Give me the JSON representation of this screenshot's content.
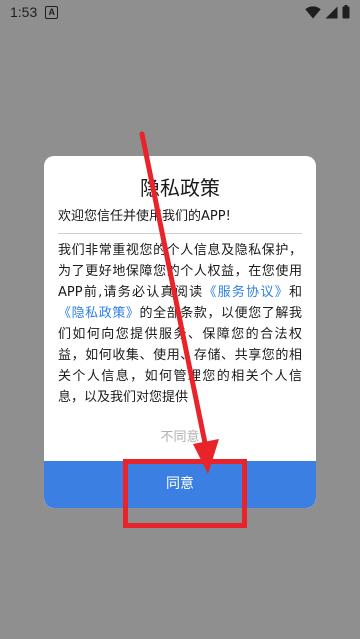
{
  "status_bar": {
    "time": "1:53",
    "notification_letter": "A"
  },
  "dialog": {
    "title": "隐私政策",
    "welcome": "欢迎您信任并使用我们的APP!",
    "body": {
      "part1": "我们非常重视您的个人信息及隐私保护，为了更好地保障您的个人权益，在您使用APP前,请务必认真阅读",
      "link1": "《服务协议》",
      "part2": "和",
      "link2": "《隐私政策》",
      "part3": "的全部条款，以便您了解我们如何向您提供服务、保障您的合法权益，如何收集、使用、存储、共享您的相关个人信息，如何管理您的相关个人信息，以及我们对您提供"
    },
    "disagree_label": "不同意",
    "agree_label": "同意"
  },
  "colors": {
    "overlay_background": "#8f8f8f",
    "agree_button": "#3c7fe3",
    "link": "#2f7fe6",
    "annotation_red": "#e8232a"
  },
  "icons": [
    "wifi-icon",
    "cellular-signal-icon",
    "battery-icon",
    "red-arrow-annotation",
    "red-box-annotation"
  ]
}
